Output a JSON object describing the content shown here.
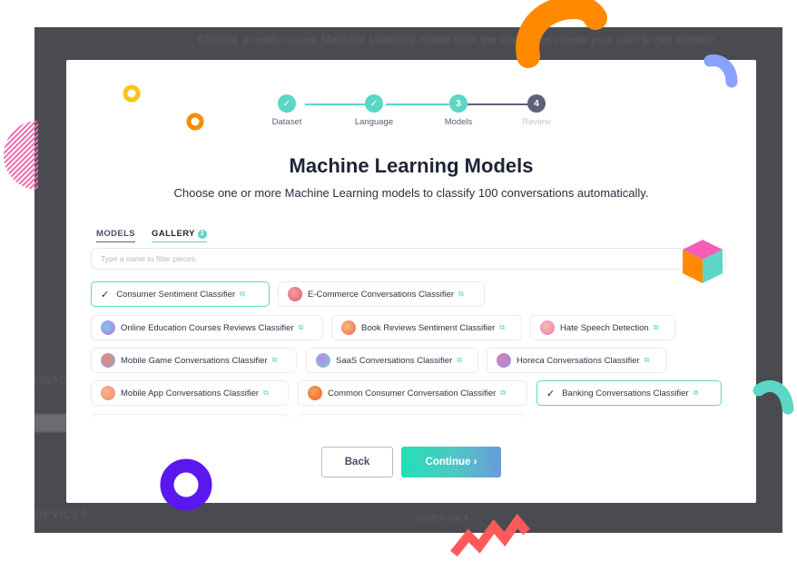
{
  "background": {
    "header_text": "Choose a ready-to-use Machine Learning model from the Gallery or create your own to get started!",
    "left_label": "USAGE",
    "bottom_left_label": "DEVICES",
    "bottom_support_label": "SUPPORT"
  },
  "stepper": {
    "steps": [
      {
        "label": "Dataset",
        "marker": "✓",
        "state": "done"
      },
      {
        "label": "Language",
        "marker": "✓",
        "state": "done"
      },
      {
        "label": "Models",
        "marker": "3",
        "state": "active"
      },
      {
        "label": "Review",
        "marker": "4",
        "state": "future"
      }
    ]
  },
  "header": {
    "title": "Machine Learning Models",
    "subtitle": "Choose one or more Machine Learning models to classify 100 conversations automatically."
  },
  "tabs": [
    {
      "label": "MODELS"
    },
    {
      "label": "GALLERY",
      "badge": "2"
    }
  ],
  "filter": {
    "placeholder": "Type a name to filter pieces.",
    "value": ""
  },
  "models": [
    {
      "label": "Consumer Sentiment Classifier",
      "selected": true,
      "icon": "check-icon"
    },
    {
      "label": "E-Commerce Conversations Classifier",
      "selected": false,
      "icon": "shopping-bag-icon",
      "color": "#ef6b6b"
    },
    {
      "label": "Online Education Courses Reviews Classifier",
      "selected": false,
      "icon": "education-icon",
      "color": "#9a8be0"
    },
    {
      "label": "Book Reviews Sentiment Classifier",
      "selected": false,
      "icon": "book-icon",
      "color": "#f07a5a"
    },
    {
      "label": "Hate Speech Detection",
      "selected": false,
      "icon": "hate-speech-icon",
      "color": "#f47fae"
    },
    {
      "label": "Mobile Game Conversations Classifier",
      "selected": false,
      "icon": "game-icon",
      "color": "#e86b7a"
    },
    {
      "label": "SaaS Conversations Classifier",
      "selected": false,
      "icon": "saas-icon",
      "color": "#9d64dc"
    },
    {
      "label": "Horeca Conversations Classifier",
      "selected": false,
      "icon": "horeca-icon",
      "color": "#c26bd8"
    },
    {
      "label": "Mobile App Conversations Classifier",
      "selected": false,
      "icon": "mobile-app-icon",
      "color": "#f5a47a"
    },
    {
      "label": "Common Consumer Conversation Classifier",
      "selected": false,
      "icon": "consumer-icon",
      "color": "#f57a2a"
    },
    {
      "label": "Banking Conversations Classifier",
      "selected": true,
      "icon": "check-icon"
    }
  ],
  "actions": {
    "back_label": "Back",
    "continue_label": "Continue ›"
  },
  "colors": {
    "accent": "#5cd6c5",
    "dark": "#1f2337",
    "backdrop": "#4a4b50"
  }
}
